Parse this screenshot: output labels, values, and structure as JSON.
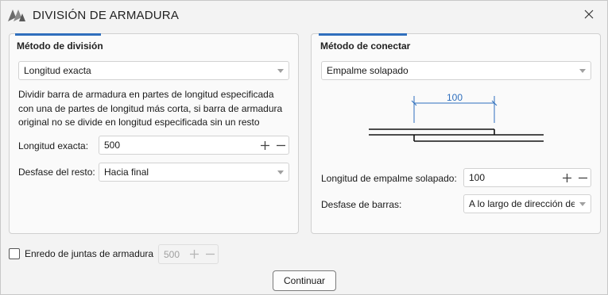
{
  "window": {
    "title": "DIVISIÓN DE ARMADURA"
  },
  "division": {
    "title": "Método de división",
    "method_value": "Longitud exacta",
    "description_lines": [
      "Dividir barra de armadura en partes de longitud especificada",
      "con una de partes de longitud más corta, si barra de armadura",
      "original no se divide en longitud especificada sin un resto"
    ],
    "length_label": "Longitud exacta:",
    "length_value": "500",
    "offset_label": "Desfase del resto:",
    "offset_value": "Hacia final"
  },
  "connection": {
    "title": "Método de conectar",
    "method_value": "Empalme solapado",
    "diagram_dimension": "100",
    "lap_length_label": "Longitud de empalme solapado:",
    "lap_length_value": "100",
    "bar_offset_label": "Desfase de barras:",
    "bar_offset_value": "A lo largo de dirección de"
  },
  "joints": {
    "label": "Enredo de juntas de armadura",
    "value": "500",
    "checked": false
  },
  "footer": {
    "continue_label": "Continuar"
  },
  "icons": {
    "logo": "app-logo-icon",
    "close": "close-icon",
    "dropdown": "chevron-down-icon",
    "plus": "plus-icon",
    "minus": "minus-icon"
  },
  "colors": {
    "accent": "#2f6fbd",
    "dimension": "#2f6fbd"
  }
}
